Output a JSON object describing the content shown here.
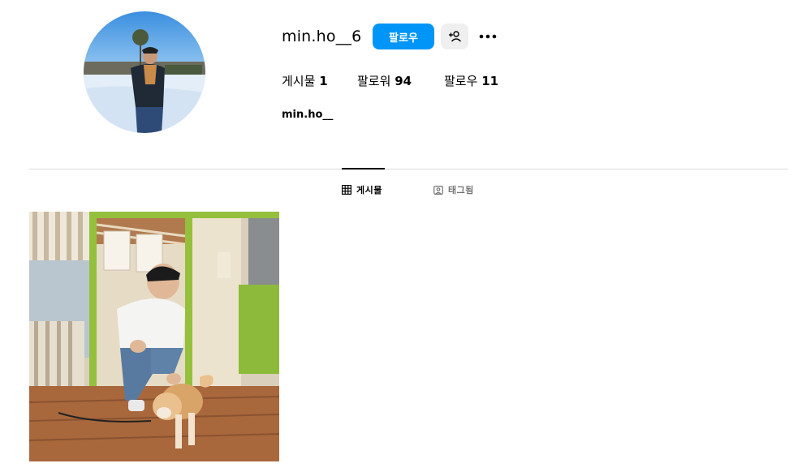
{
  "profile": {
    "username": "min.ho__6",
    "display_name": "min.ho__",
    "follow_label": "팔로우",
    "stats": [
      {
        "label": "게시물",
        "value": "1"
      },
      {
        "label": "팔로워",
        "value": "94"
      },
      {
        "label": "팔로우",
        "value": "11"
      }
    ]
  },
  "tabs": [
    {
      "label": "게시물",
      "icon": "grid-icon",
      "active": true
    },
    {
      "label": "태그됨",
      "icon": "tagged-icon",
      "active": false
    }
  ],
  "icons": {
    "suggest": "add-person-icon",
    "more": "more-options-icon"
  },
  "colors": {
    "follow_button": "#0095f6",
    "secondary_button": "#efefef",
    "divider": "#dbdbdb"
  }
}
